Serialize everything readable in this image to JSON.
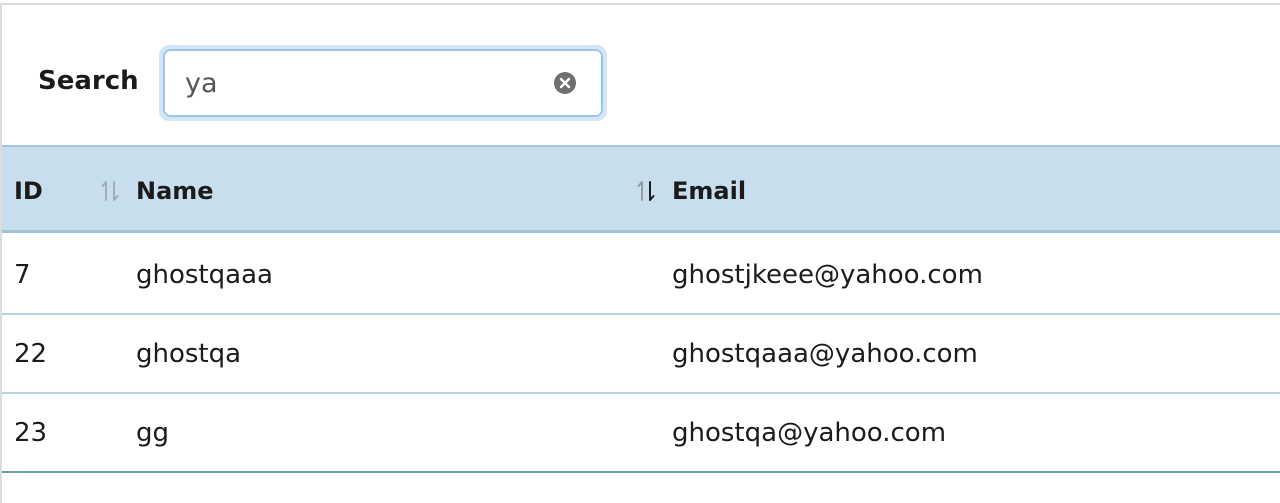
{
  "search": {
    "label": "Search",
    "value": "ya",
    "placeholder": ""
  },
  "table": {
    "columns": [
      "ID",
      "Name",
      "Email"
    ],
    "rows": [
      {
        "id": "7",
        "name": "ghostqaaa",
        "email": "ghostjkeee@yahoo.com"
      },
      {
        "id": "22",
        "name": "ghostqa",
        "email": "ghostqaaa@yahoo.com"
      },
      {
        "id": "23",
        "name": "gg",
        "email": "ghostqa@yahoo.com"
      }
    ]
  },
  "icons": {
    "clear": "clear-circle-x-icon",
    "sort": "sort-updown-arrows-icon"
  },
  "colors": {
    "header_bg": "#c8deed",
    "input_focus_ring": "#d2e6f7",
    "input_border": "#9cc5ea",
    "row_divider": "#b7d2e5"
  }
}
